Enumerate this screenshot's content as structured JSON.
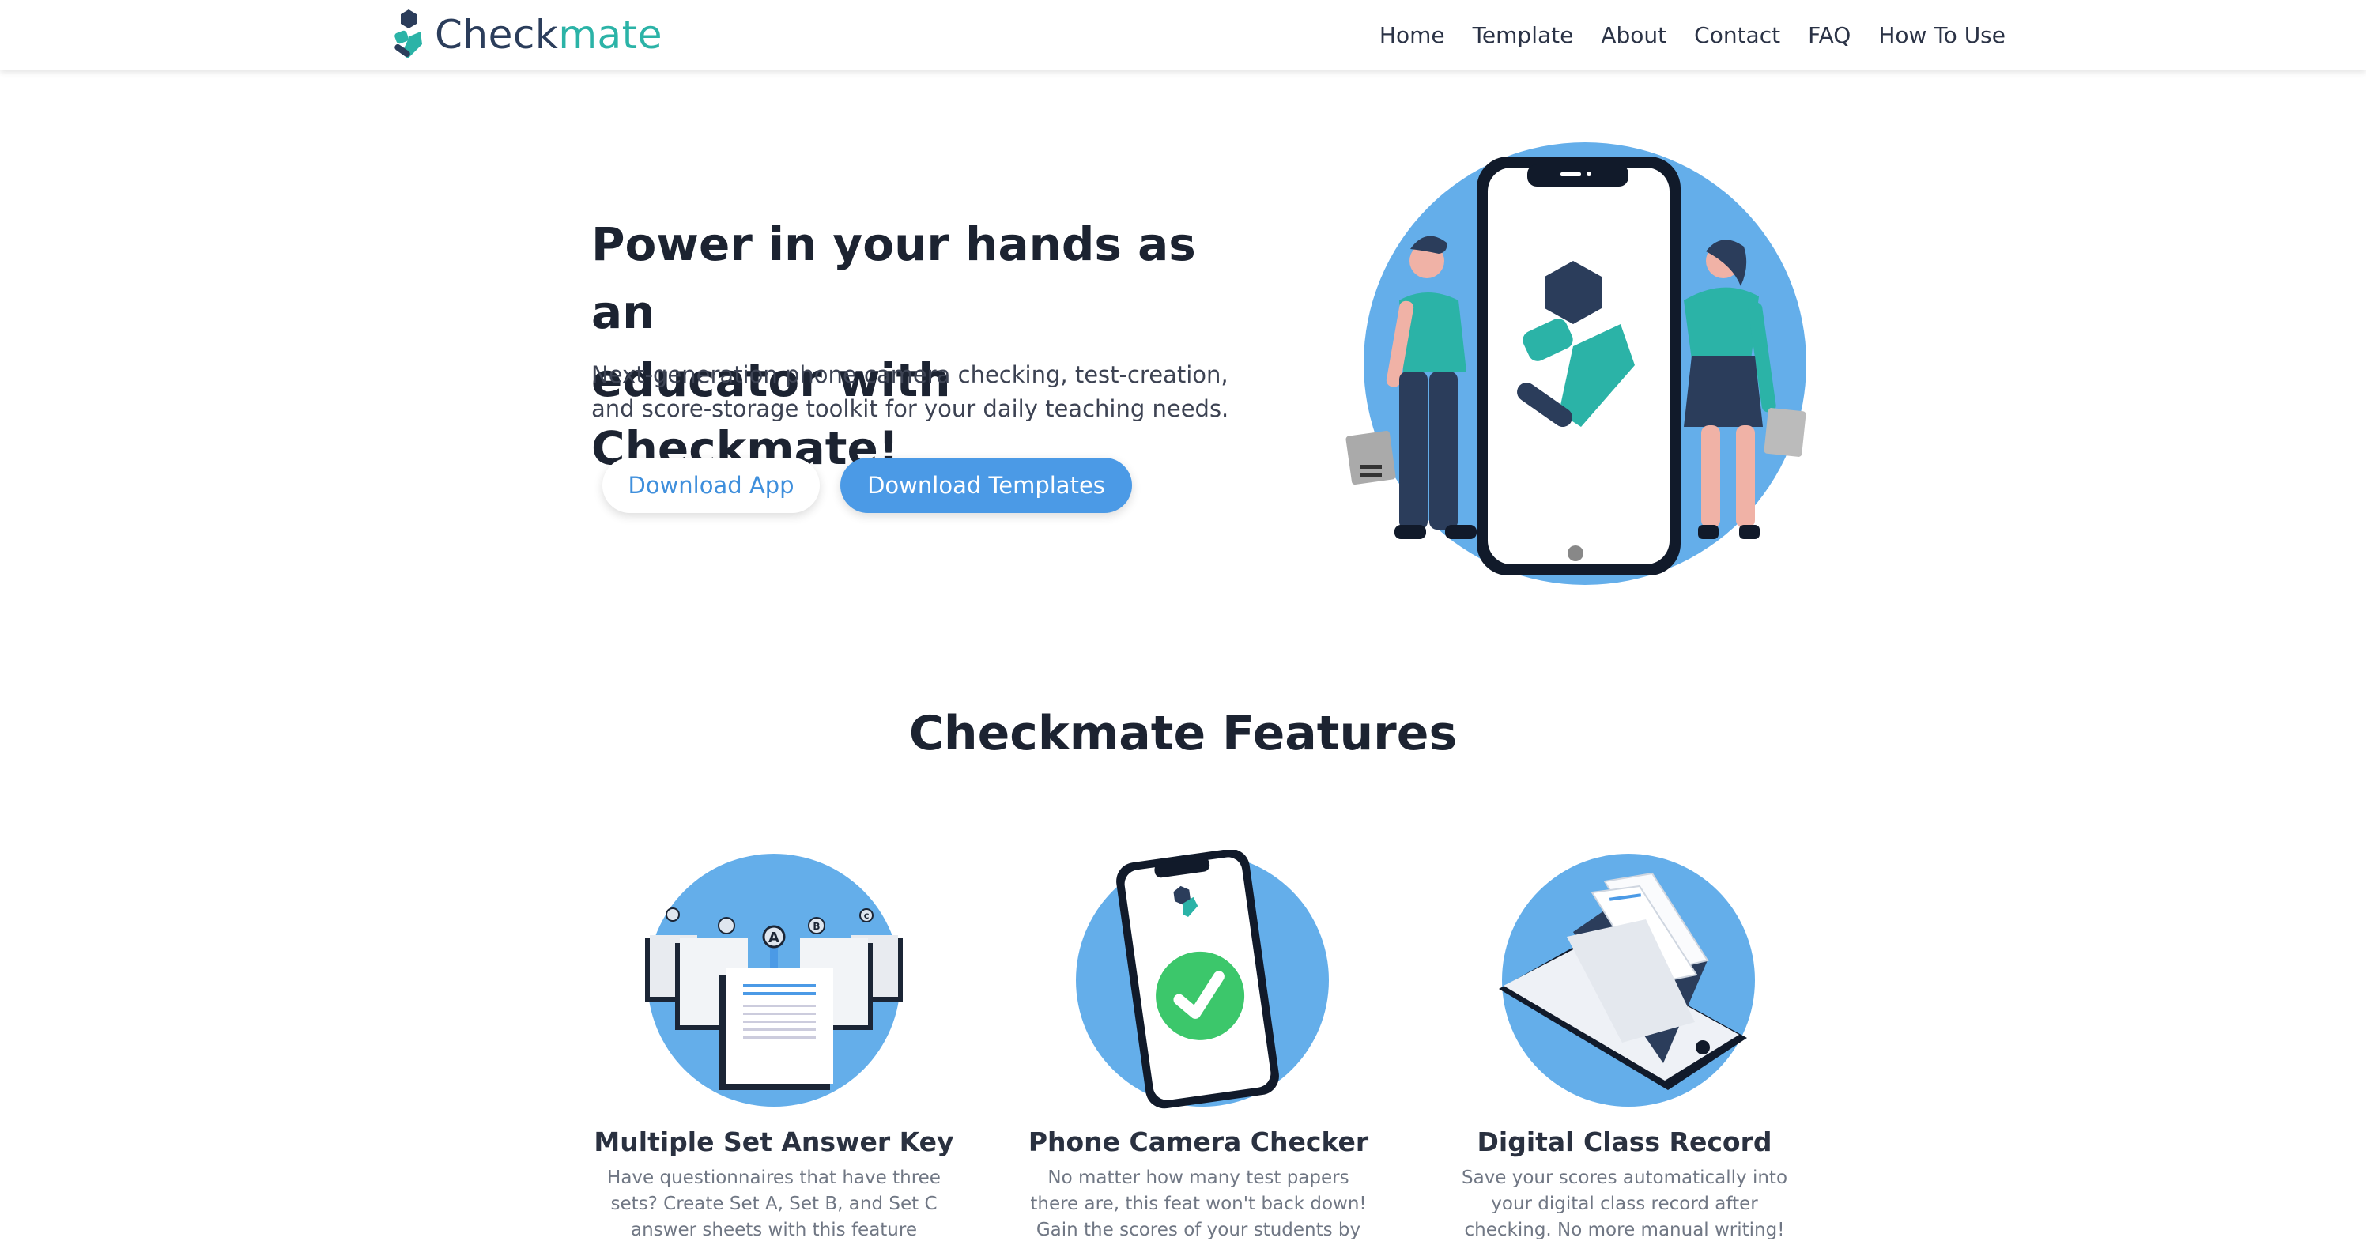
{
  "brand": {
    "name_part1": "Check",
    "name_part2": "mate"
  },
  "nav": {
    "items": [
      {
        "label": "Home"
      },
      {
        "label": "Template"
      },
      {
        "label": "About"
      },
      {
        "label": "Contact"
      },
      {
        "label": "FAQ"
      },
      {
        "label": "How To Use"
      }
    ]
  },
  "hero": {
    "title_line1": "Power in your hands as an",
    "title_line2": "educator with Checkmate!",
    "subtitle_line1": "Next-generation phone camera checking, test-creation,",
    "subtitle_line2": "and score-storage toolkit for your daily teaching needs.",
    "btn_app": "Download App",
    "btn_templates": "Download Templates"
  },
  "features": {
    "title": "Checkmate Features",
    "items": [
      {
        "title": "Multiple Set Answer Key",
        "desc": "Have questionnaires that have three sets? Create Set A, Set B, and Set C answer sheets with this feature",
        "badge_a": "A",
        "badge_b": "B",
        "badge_c": "C"
      },
      {
        "title": "Phone Camera Checker",
        "desc": "No matter how many test papers there are, this feat won't back down! Gain the scores of your students by hovering the"
      },
      {
        "title": "Digital Class Record",
        "desc": "Save your scores automatically into your digital class record after checking. No more manual writing! Sorting can also"
      }
    ]
  },
  "colors": {
    "brand_dark": "#2b3d5b",
    "brand_teal": "#2bb3a7",
    "accent_blue": "#4b9ae6",
    "circle_blue": "#64aeea",
    "check_green": "#3cc76b"
  },
  "icons": {
    "logo": "checkmate-logo-icon",
    "hero": "phone-people-illustration",
    "feature1": "answer-sheets-illustration",
    "feature2": "phone-check-illustration",
    "feature3": "tablet-folder-illustration"
  }
}
